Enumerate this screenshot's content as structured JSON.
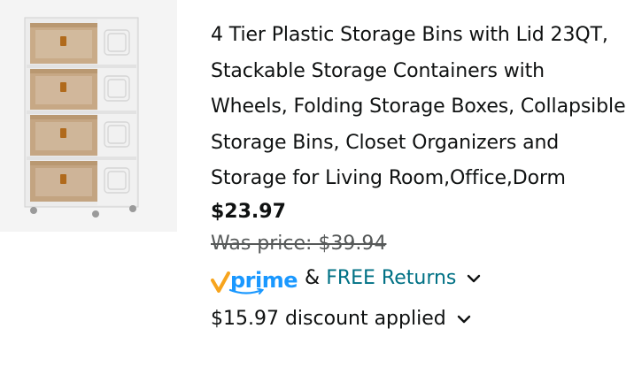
{
  "product": {
    "title": "4 Tier Plastic Storage Bins with Lid 23QT, Stackable Storage Containers with Wheels, Folding Storage Boxes, Collapsible Storage Bins, Closet Organizers and Storage for Living Room,Office,Dorm",
    "price": "$23.97",
    "was_price": "Was price: $39.94",
    "prime": "prime",
    "amp": "&",
    "free_returns": "FREE Returns",
    "discount": "$15.97 discount applied",
    "image_icon": "storage-cabinet-image",
    "colors": {
      "prime_blue": "#1a98ff",
      "prime_check": "#f7a41d",
      "link": "#007185",
      "muted": "#565959"
    }
  }
}
